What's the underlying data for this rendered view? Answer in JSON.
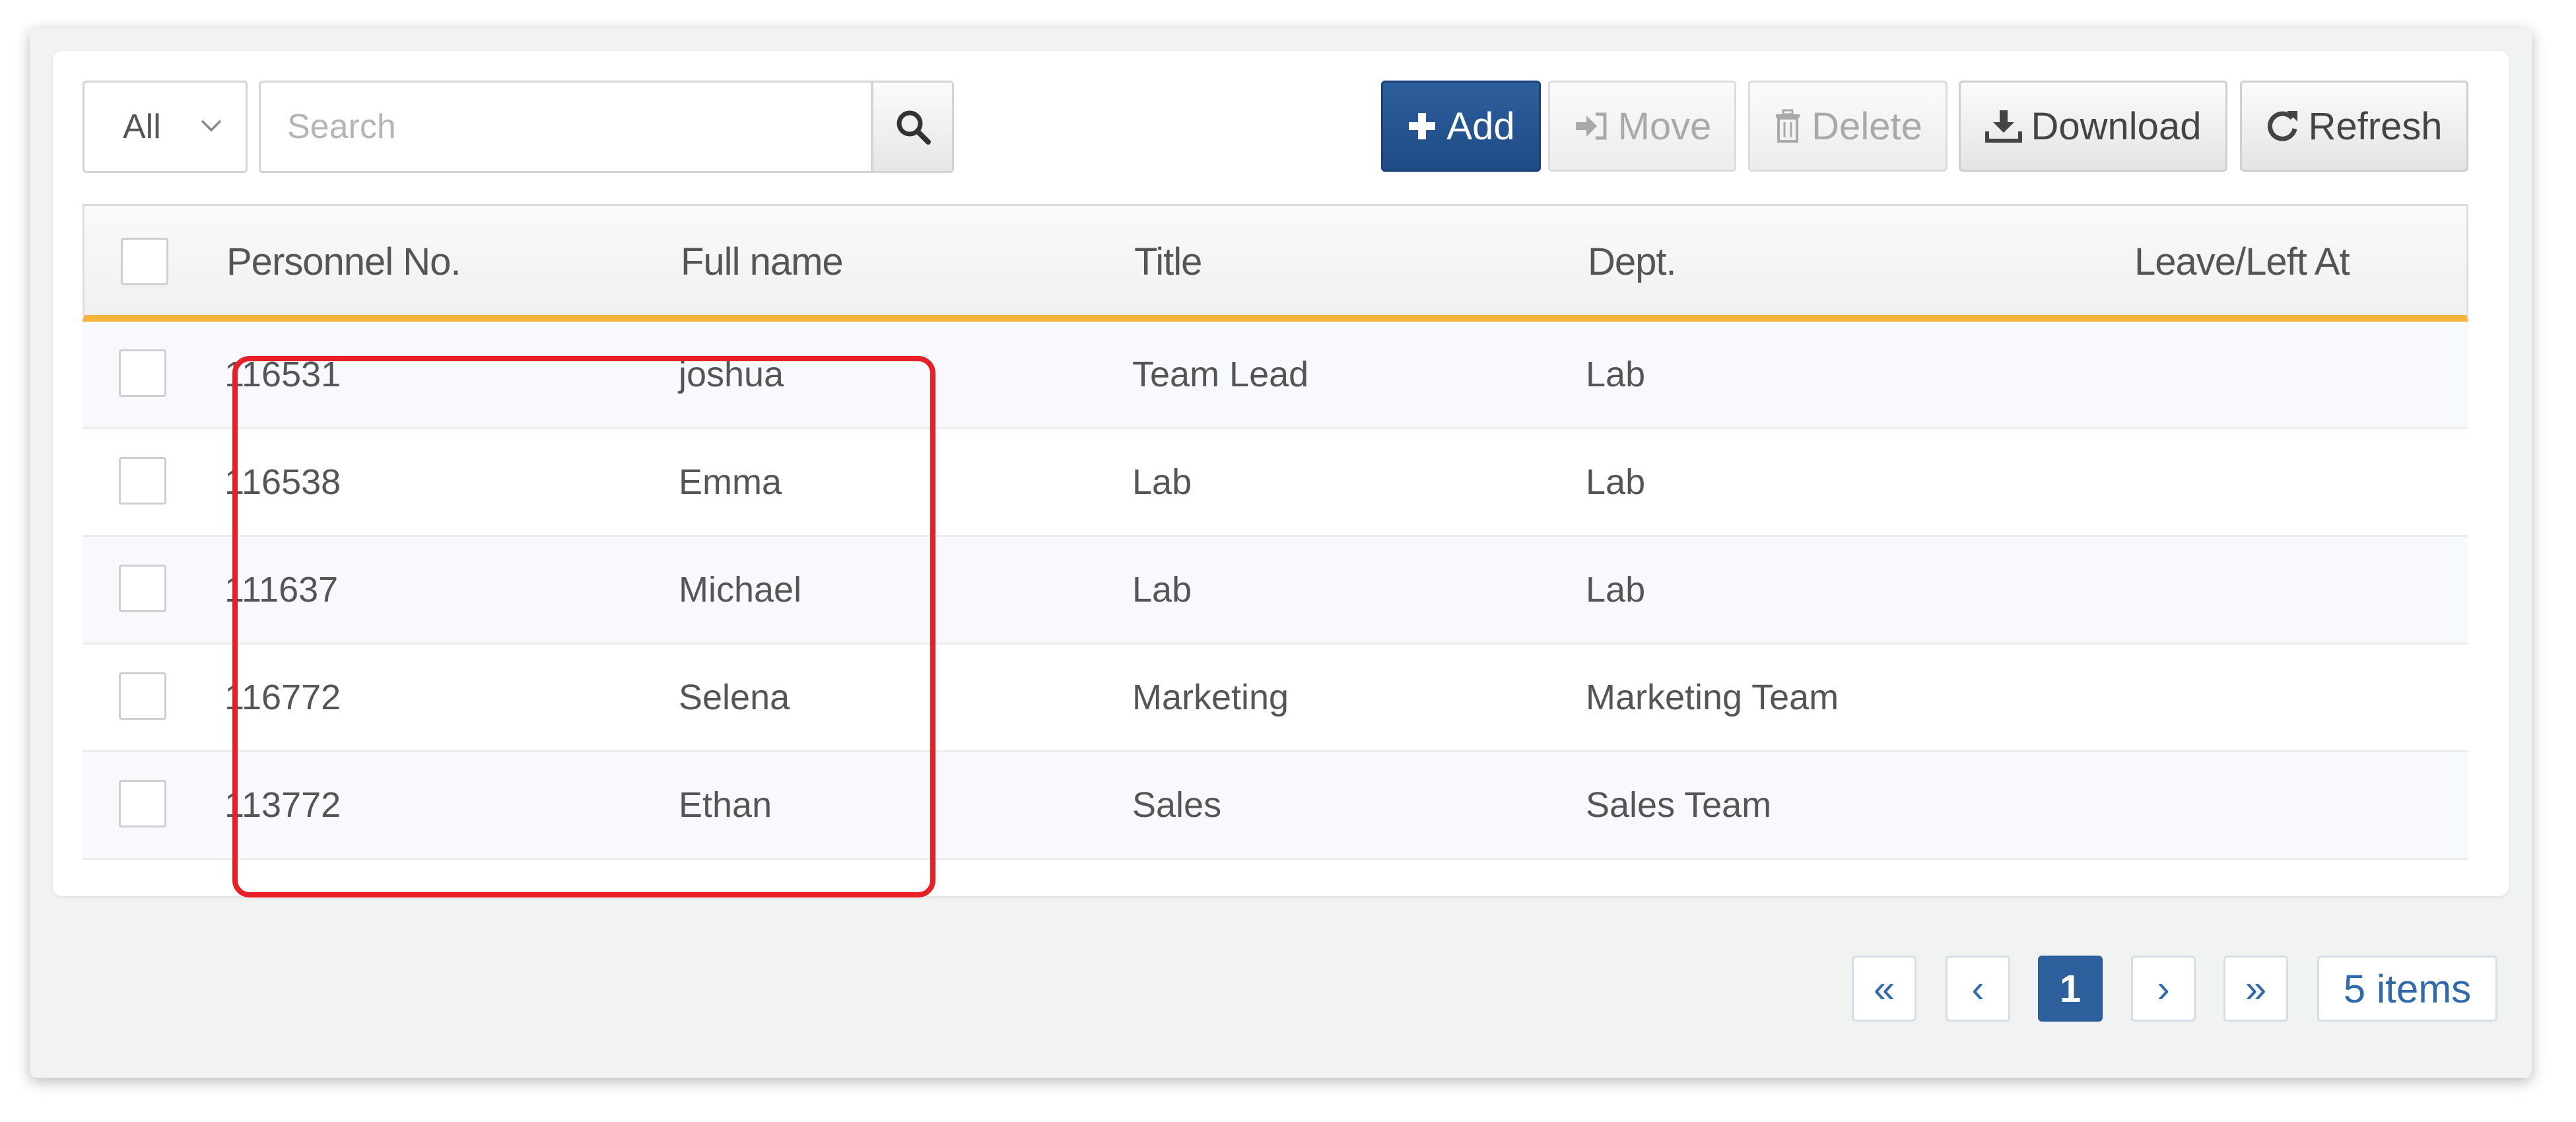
{
  "toolbar": {
    "filter_value": "All",
    "search_placeholder": "Search",
    "search_value": "",
    "buttons": {
      "add": "Add",
      "move": "Move",
      "delete": "Delete",
      "download": "Download",
      "refresh": "Refresh"
    }
  },
  "table": {
    "headers": {
      "personnel_no": "Personnel No.",
      "full_name": "Full name",
      "title": "Title",
      "dept": "Dept.",
      "leave": "Leave/Left At"
    },
    "rows": [
      {
        "personnel_no": "116531",
        "full_name": "joshua",
        "title": "Team Lead",
        "dept": "Lab",
        "leave": ""
      },
      {
        "personnel_no": "116538",
        "full_name": "Emma",
        "title": "Lab",
        "dept": "Lab",
        "leave": ""
      },
      {
        "personnel_no": "111637",
        "full_name": "Michael",
        "title": "Lab",
        "dept": "Lab",
        "leave": ""
      },
      {
        "personnel_no": "116772",
        "full_name": "Selena",
        "title": "Marketing",
        "dept": "Marketing Team",
        "leave": ""
      },
      {
        "personnel_no": "113772",
        "full_name": "Ethan",
        "title": "Sales",
        "dept": "Sales Team",
        "leave": ""
      }
    ]
  },
  "pagination": {
    "first": "«",
    "prev": "‹",
    "current_page": "1",
    "next": "›",
    "last": "»",
    "count": "5 items"
  },
  "colors": {
    "primary": "#2d5f9c",
    "header_accent": "#f3b43a",
    "highlight": "#ea1f25"
  }
}
